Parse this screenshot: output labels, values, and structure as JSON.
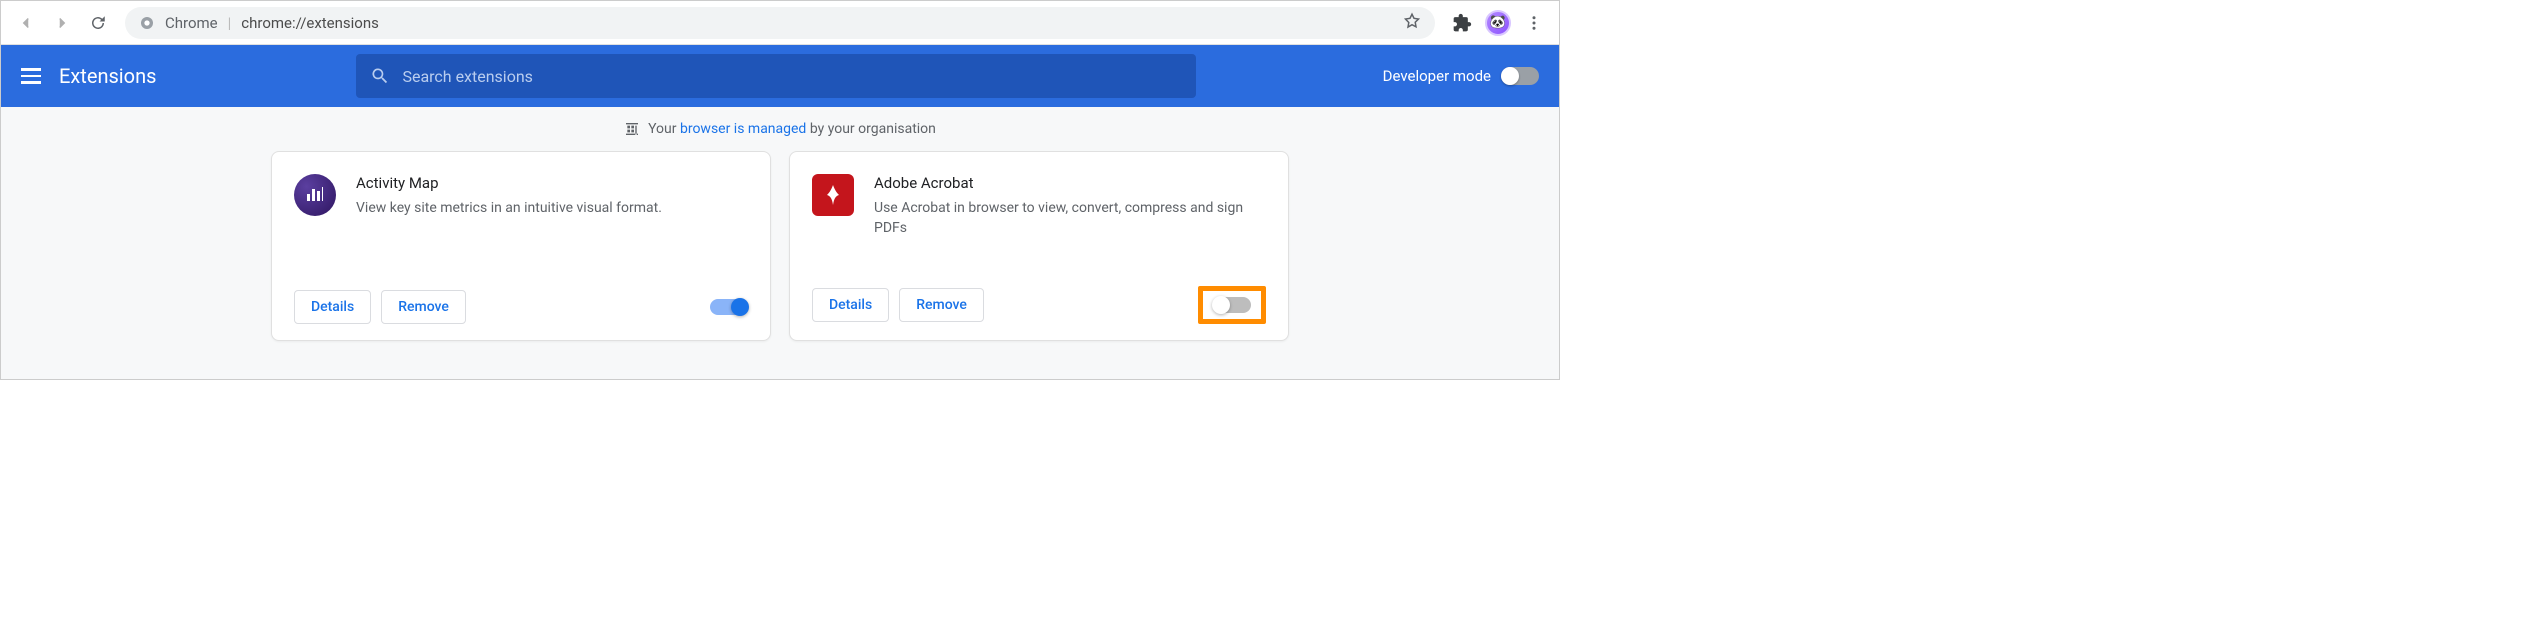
{
  "browser": {
    "app_label": "Chrome",
    "url": "chrome://extensions"
  },
  "header": {
    "title": "Extensions",
    "search_placeholder": "Search extensions",
    "dev_mode_label": "Developer mode"
  },
  "managed_notice": {
    "prefix": "Your ",
    "link_text": "browser is managed",
    "suffix": " by your organisation"
  },
  "buttons": {
    "details": "Details",
    "remove": "Remove"
  },
  "extensions": [
    {
      "name": "Activity Map",
      "description": "View key site metrics in an intuitive visual format.",
      "enabled": true,
      "highlight": false,
      "icon": "chart"
    },
    {
      "name": "Adobe Acrobat",
      "description": "Use Acrobat in browser to view, convert, compress and sign PDFs",
      "enabled": false,
      "highlight": true,
      "icon": "acrobat"
    }
  ]
}
